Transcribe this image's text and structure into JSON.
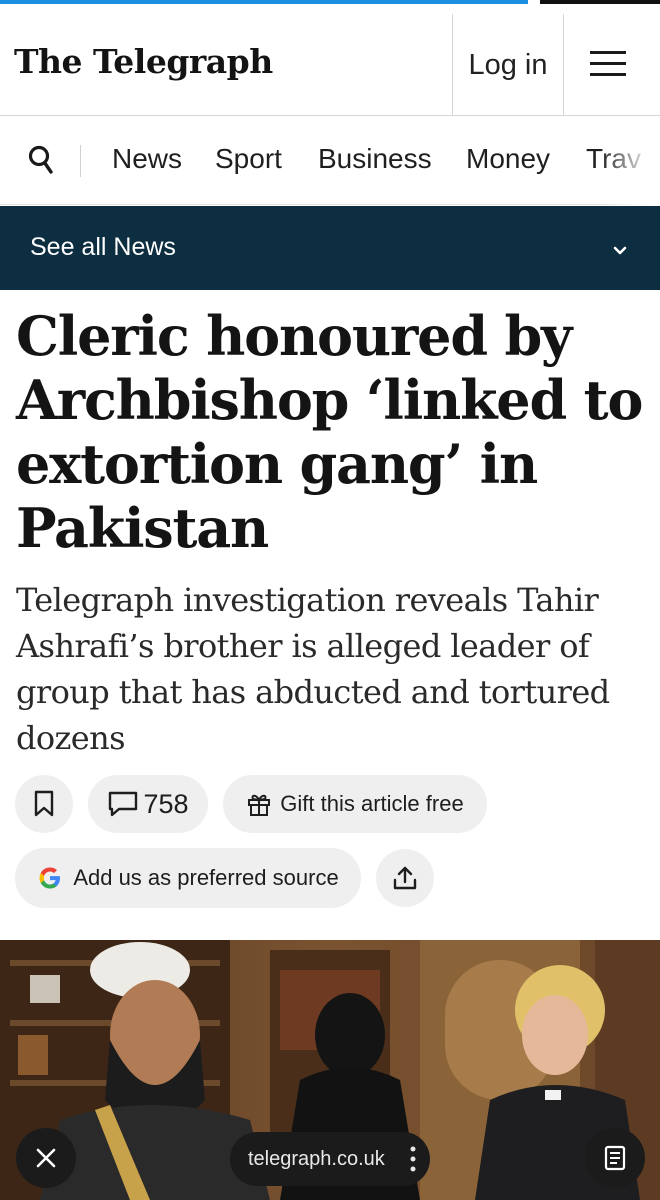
{
  "page_progress_percent": 80,
  "header": {
    "logo": "The Telegraph",
    "login_label": "Log in",
    "menu_icon": "hamburger-menu-icon"
  },
  "nav": {
    "search_icon": "search-icon",
    "items": [
      "News",
      "Sport",
      "Business",
      "Money",
      "Trav"
    ]
  },
  "section": {
    "label": "See all News",
    "chevron_icon": "chevron-down-icon"
  },
  "article": {
    "headline": "Cleric honoured by Archbishop ‘linked to extortion gang’ in Pakistan",
    "standfirst": "Telegraph investigation reveals Tahir Ashrafi’s brother is alleged leader of group that has abducted and tortured dozens"
  },
  "actions": {
    "bookmark_icon": "bookmark-icon",
    "comment_count": "758",
    "gift_label": "Gift this article free",
    "preferred_source_label": "Add us as preferred source",
    "share_icon": "share-icon"
  },
  "browser": {
    "url": "telegraph.co.uk",
    "close_icon": "close-icon",
    "reader_icon": "reader-mode-icon"
  },
  "colors": {
    "section_bar": "#0d2d40",
    "progress": "#1d8fe0",
    "pill_bg": "#efefef"
  }
}
